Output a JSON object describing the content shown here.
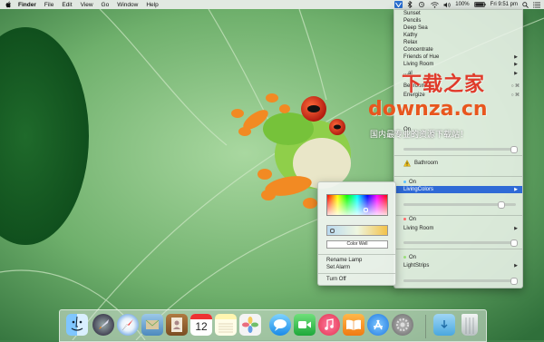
{
  "menubar": {
    "app_name": "Finder",
    "items": [
      "File",
      "Edit",
      "View",
      "Go",
      "Window",
      "Help"
    ],
    "battery": "100%",
    "clock": "Fri 9:51 pm"
  },
  "hue_menu": {
    "scenes": [
      "Sunset",
      "Pencils",
      "Deep Sea",
      "Kathy",
      "Relax",
      "Concentrate",
      "Friends of Hue",
      "Living Room"
    ],
    "overlapped_rows": [
      "...al",
      "Bedroom",
      "Energize",
      "On"
    ],
    "group1": {
      "warning_label": "Bathroom"
    },
    "group2": {
      "on_label": "On",
      "lamp_label": "LivingColors"
    },
    "group3": {
      "on_label": "On",
      "lamp_label": "Living Room"
    },
    "group4": {
      "on_label": "On",
      "lamp_label": "LightStrips"
    },
    "accent_color": "#2f6ad6"
  },
  "color_submenu": {
    "color_well_label": "Color Well",
    "rename_label": "Rename Lamp",
    "alarm_label": "Set Alarm",
    "turn_off_label": "Turn Off"
  },
  "watermark": {
    "line1": "下载之家",
    "line2": "downza.cn",
    "line3": "国内最专业的资源下载站！"
  },
  "dock": {
    "apps": [
      "finder",
      "launchpad",
      "safari",
      "mail",
      "contacts",
      "calendar",
      "notes",
      "photos",
      "messages",
      "facetime",
      "itunes",
      "ibooks",
      "app-store",
      "system-preferences",
      "downloads",
      "trash"
    ],
    "calendar_day": "12"
  }
}
